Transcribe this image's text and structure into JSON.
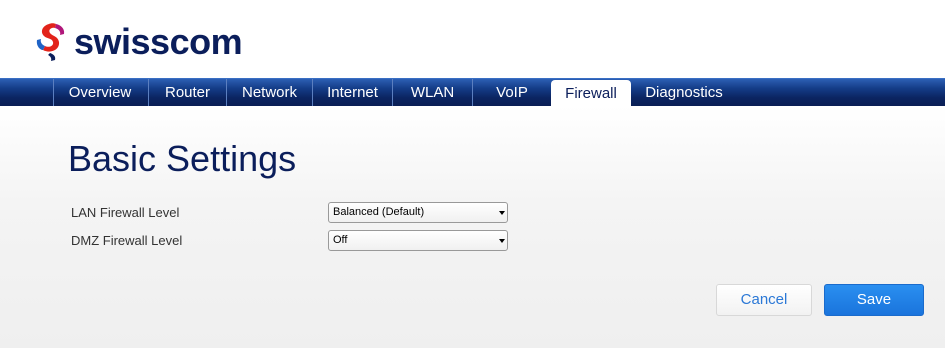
{
  "brand": {
    "name": "swisscom"
  },
  "nav": {
    "items": [
      {
        "label": "Overview",
        "active": false
      },
      {
        "label": "Router",
        "active": false
      },
      {
        "label": "Network",
        "active": false
      },
      {
        "label": "Internet",
        "active": false
      },
      {
        "label": "WLAN",
        "active": false
      },
      {
        "label": "VoIP",
        "active": false
      },
      {
        "label": "Firewall",
        "active": true
      },
      {
        "label": "Diagnostics",
        "active": false
      }
    ]
  },
  "page": {
    "title": "Basic Settings",
    "fields": [
      {
        "label": "LAN Firewall Level",
        "value": "Balanced (Default)"
      },
      {
        "label": "DMZ Firewall Level",
        "value": "Off"
      }
    ]
  },
  "actions": {
    "cancel_label": "Cancel",
    "save_label": "Save"
  },
  "colors": {
    "brand_navy": "#0b1e5b",
    "nav_blue": "#143c87",
    "primary_button": "#1a74dc",
    "logo_red": "#e2231a"
  }
}
